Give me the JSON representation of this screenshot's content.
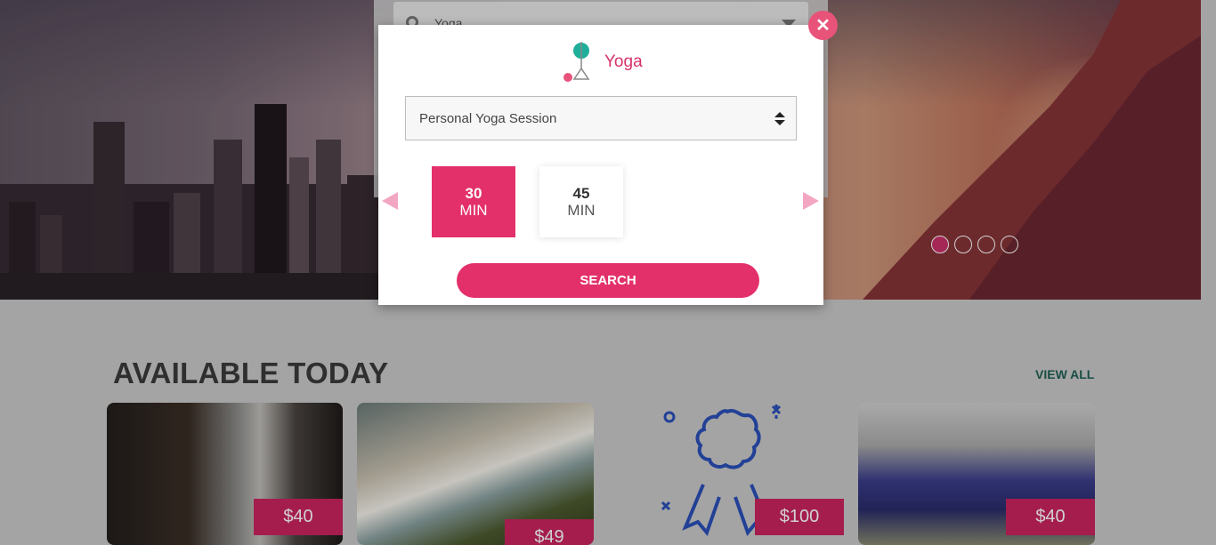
{
  "hero": {
    "carousel_dots": [
      {
        "active": true
      },
      {
        "active": false
      },
      {
        "active": false
      },
      {
        "active": false
      }
    ]
  },
  "search_bar": {
    "value": "Yoga"
  },
  "modal": {
    "category_title": "Yoga",
    "category_icon": "yoga-pose-icon",
    "session_select": {
      "selected": "Personal Yoga Session"
    },
    "durations": [
      {
        "value": "30",
        "unit": "MIN",
        "selected": true
      },
      {
        "value": "45",
        "unit": "MIN",
        "selected": false
      }
    ],
    "search_label": "SEARCH",
    "close_icon": "close-icon"
  },
  "available": {
    "title": "AVAILABLE TODAY",
    "view_all": "VIEW ALL",
    "cards": [
      {
        "price": "$40"
      },
      {
        "price": "$49"
      },
      {
        "price": "$100"
      },
      {
        "price": "$40"
      }
    ]
  },
  "colors": {
    "accent": "#e3306a",
    "price_bg": "#c8245f",
    "link": "#1f5e52"
  }
}
